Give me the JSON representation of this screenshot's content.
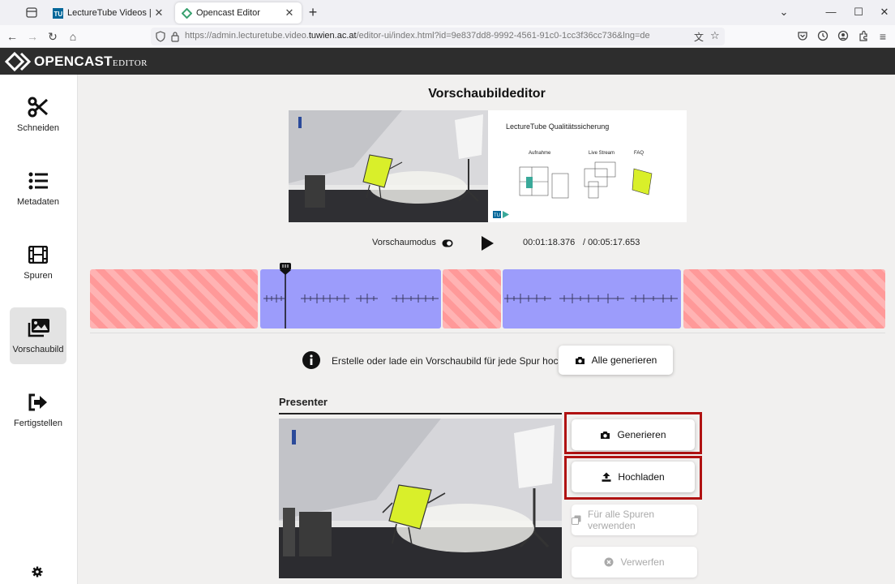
{
  "browser": {
    "tabs": [
      {
        "label": "LectureTube Videos | TUWEL",
        "active": false
      },
      {
        "label": "Opencast Editor",
        "active": true
      }
    ],
    "url_prefix": "https://admin.lecturetube.video.",
    "url_domain": "tuwien.ac.at",
    "url_suffix": "/editor-ui/index.html?id=9e837dd8-9992-4561-91c0-1cc3f36cc736&lng=de"
  },
  "app": {
    "logo_main": "OPENCAST",
    "logo_sub": "EDITOR",
    "accent_color": "#2d2d2d"
  },
  "sidebar": {
    "items": [
      {
        "label": "Schneiden",
        "icon": "scissors-icon"
      },
      {
        "label": "Metadaten",
        "icon": "list-icon"
      },
      {
        "label": "Spuren",
        "icon": "film-icon"
      },
      {
        "label": "Vorschaubild",
        "icon": "images-icon",
        "active": true
      },
      {
        "label": "Fertigstellen",
        "icon": "sign-out-icon"
      }
    ],
    "settings_icon": "gear-icon"
  },
  "main": {
    "title": "Vorschaubildeditor",
    "slide": {
      "title": "LectureTube Qualitätssicherung",
      "labels": [
        "Aufnahme",
        "Live Stream",
        "FAQ"
      ]
    },
    "player": {
      "preview_mode_label": "Vorschaumodus",
      "current_time": "00:01:18.376",
      "total_time": "/ 00:05:17.653"
    },
    "timeline": {
      "segment_colors": {
        "kept": "#9c9cfb",
        "deleted": "#ff9999"
      }
    },
    "info_text": "Erstelle oder lade ein Vorschaubild für jede Spur hoch.",
    "generate_all_label": "Alle generieren",
    "track": {
      "title": "Presenter",
      "generate_label": "Generieren",
      "upload_label": "Hochladen",
      "use_for_all_label": "Für alle Spuren verwenden",
      "discard_label": "Verwerfen"
    },
    "highlight_color": "#b01212"
  }
}
